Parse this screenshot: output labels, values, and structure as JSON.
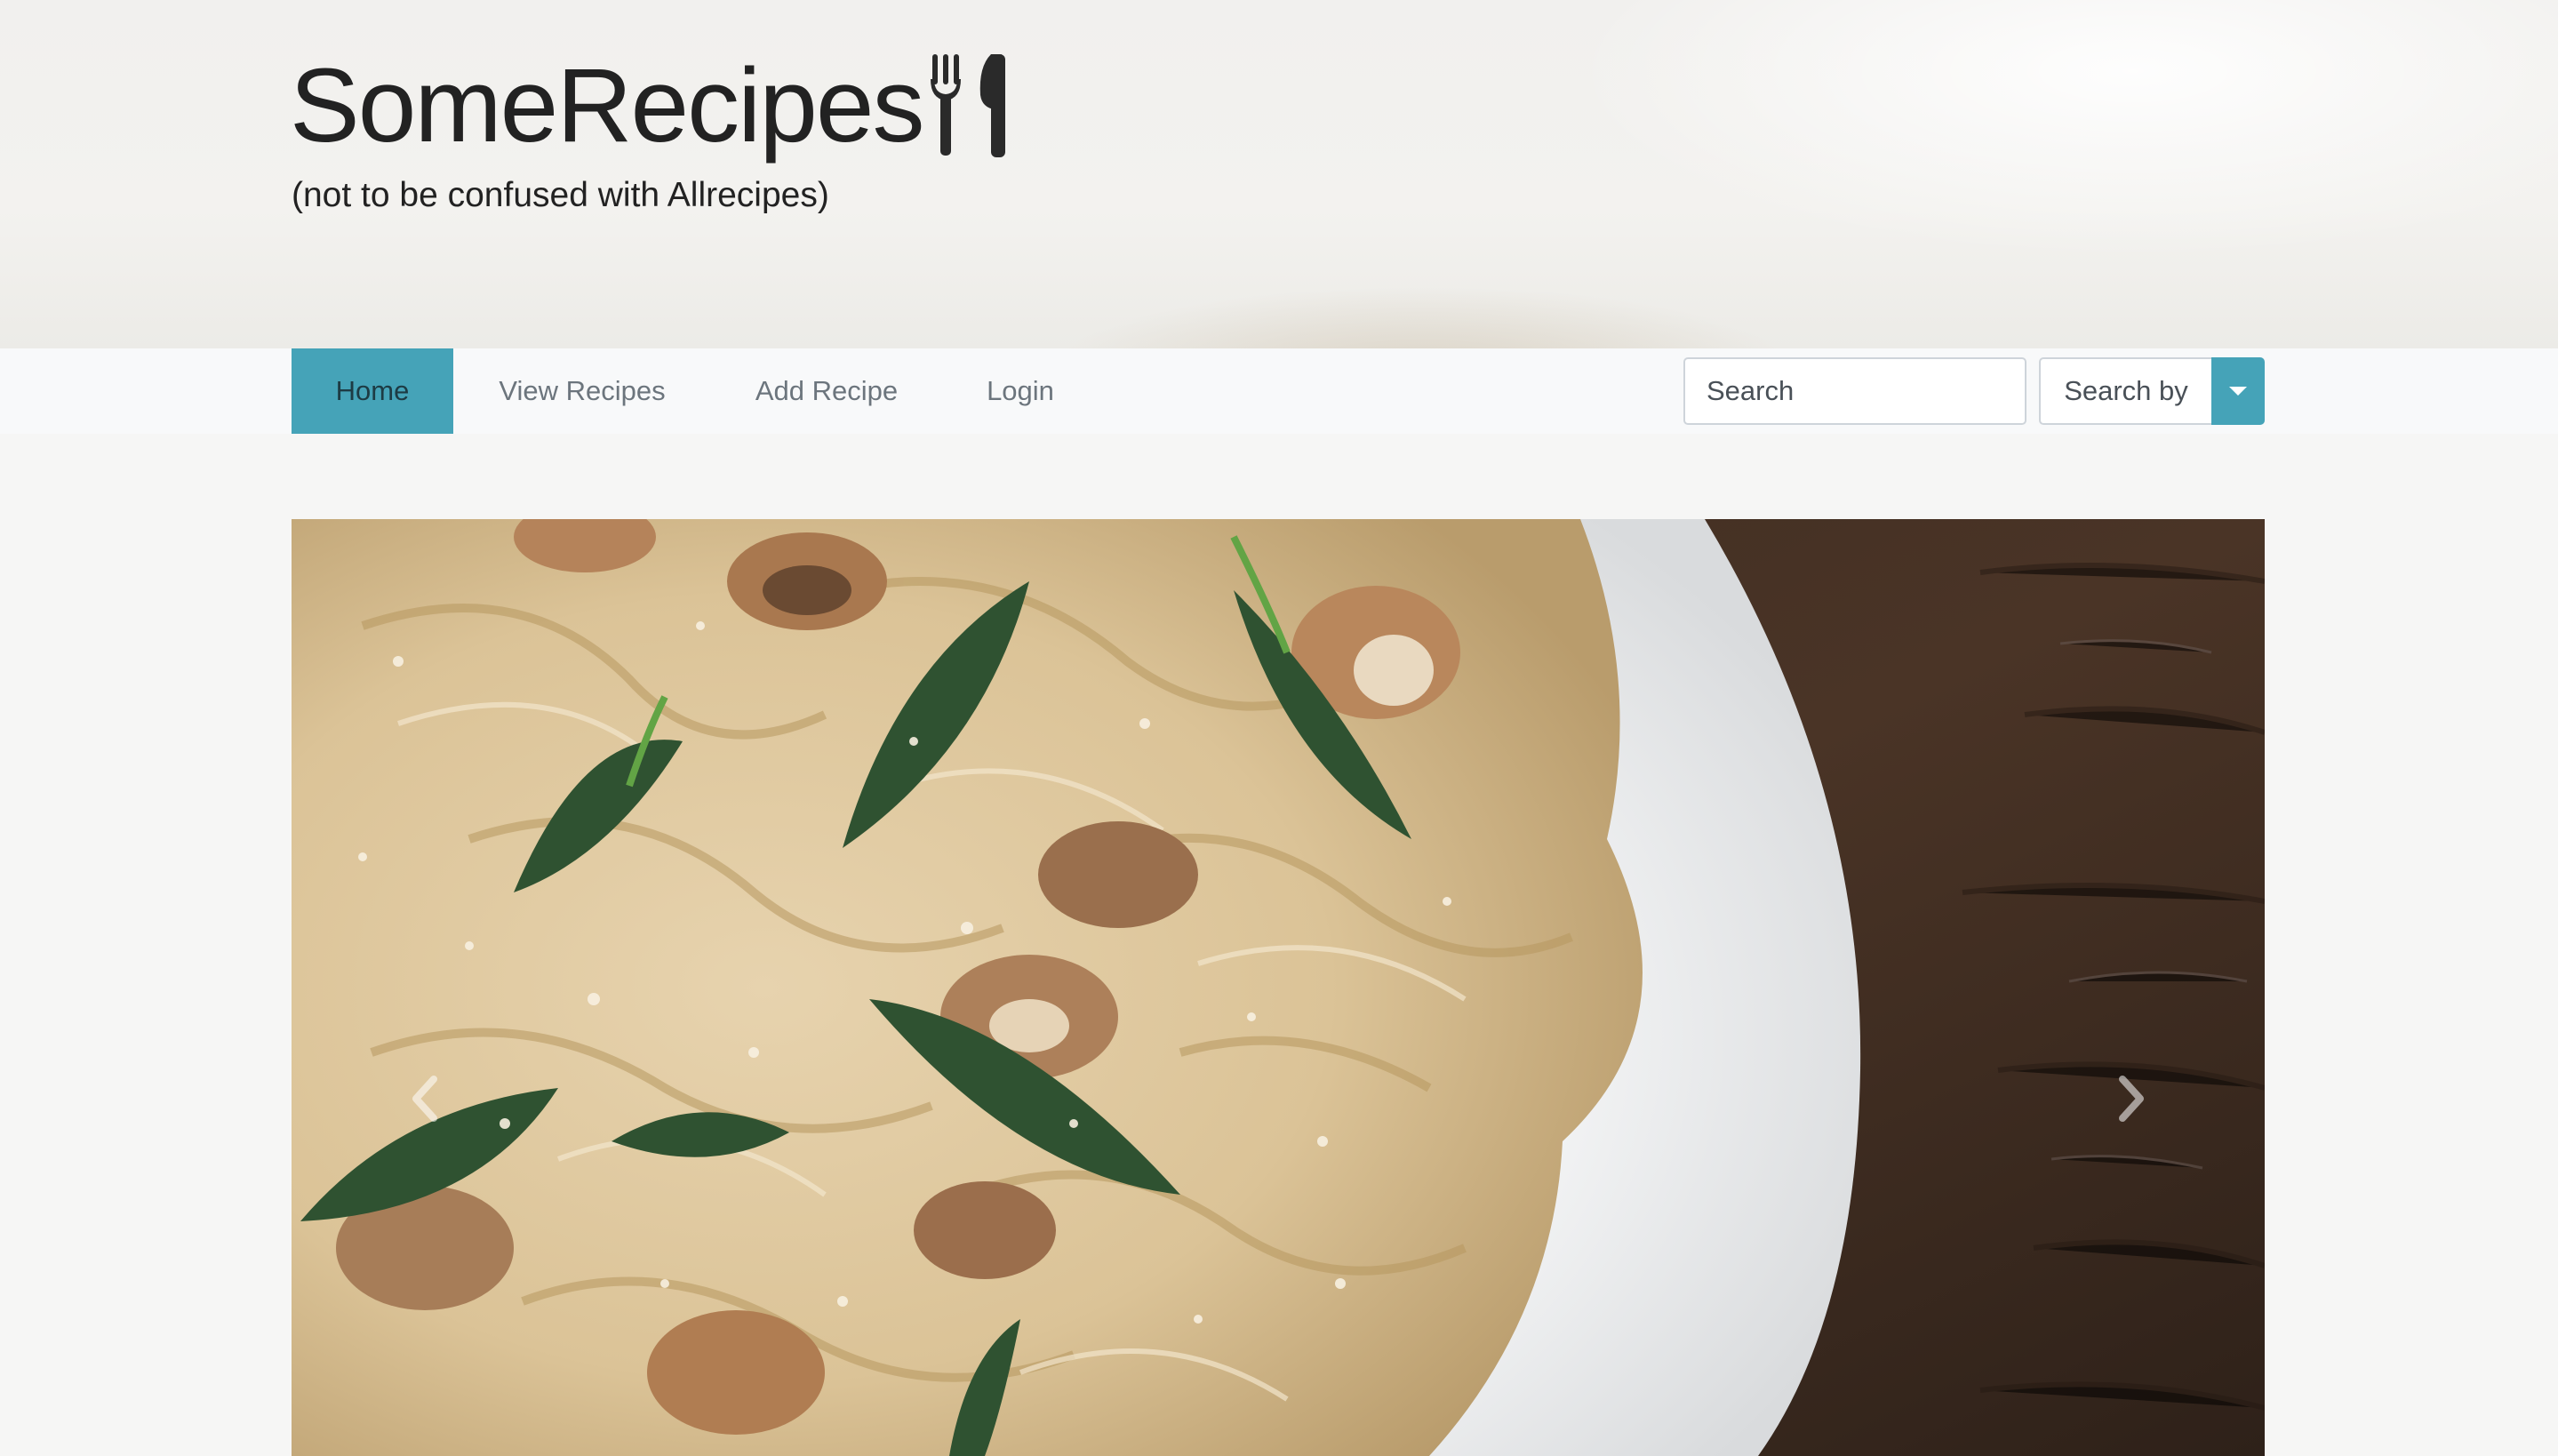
{
  "brand": {
    "title": "SomeRecipes",
    "tagline": "(not to be confused with Allrecipes)",
    "icon": "utensils-icon"
  },
  "nav": {
    "items": [
      {
        "label": "Home",
        "active": true
      },
      {
        "label": "View Recipes",
        "active": false
      },
      {
        "label": "Add Recipe",
        "active": false
      },
      {
        "label": "Login",
        "active": false
      }
    ]
  },
  "search": {
    "placeholder": "Search",
    "searchby_label": "Search by"
  },
  "carousel": {
    "prev_icon": "chevron-left-icon",
    "next_icon": "chevron-right-icon"
  },
  "colors": {
    "accent": "#45a3b8",
    "navbar_bg": "#f8f9fa",
    "page_bg": "#f6f6f5"
  }
}
